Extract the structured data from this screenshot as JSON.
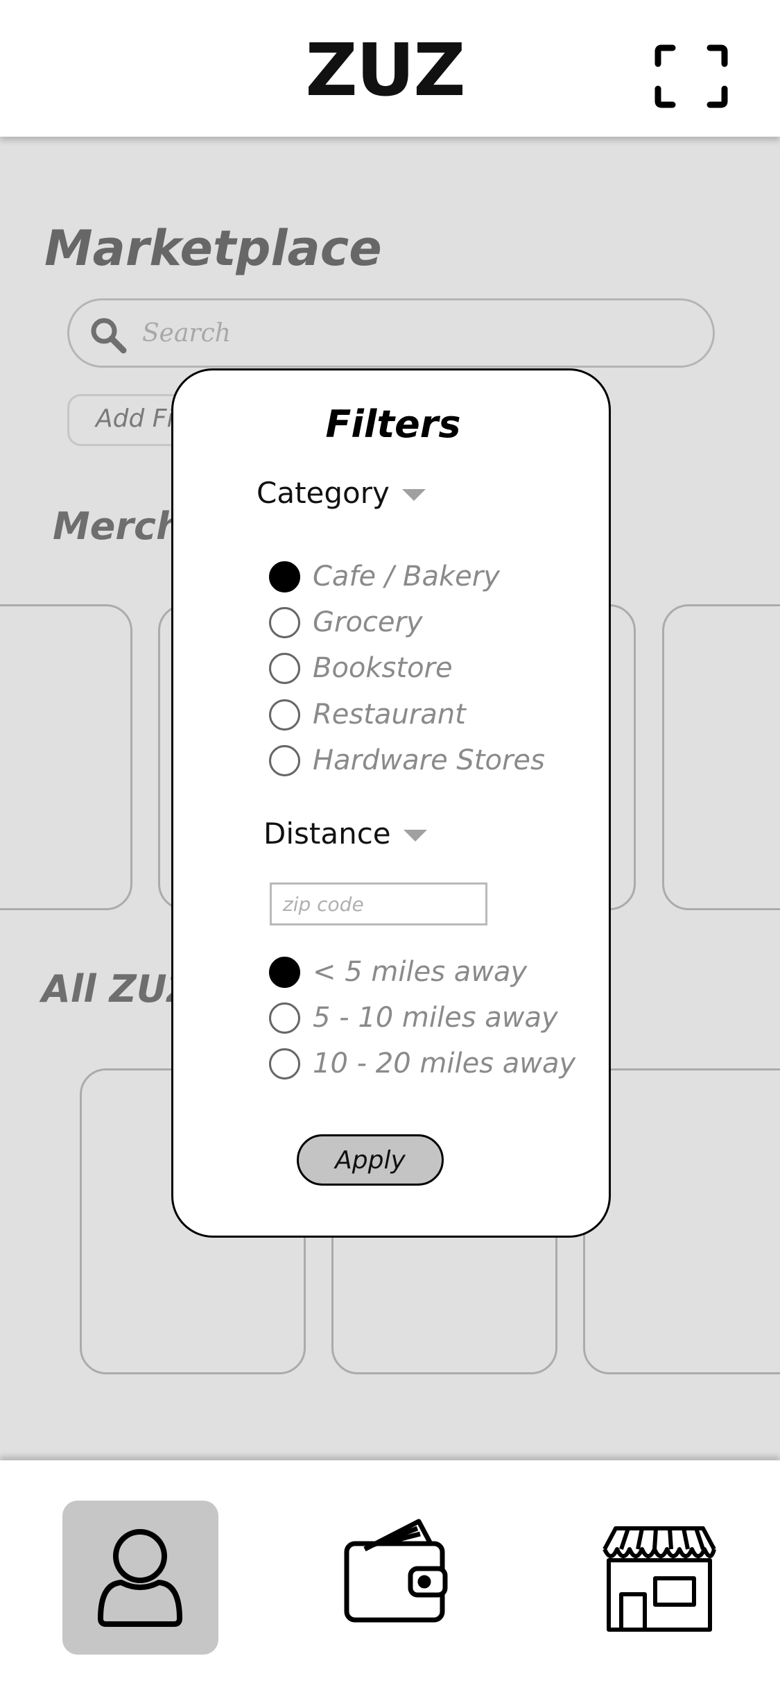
{
  "app": {
    "logo": "ZUZ"
  },
  "header": {
    "scan_icon": "scan-frame-icon"
  },
  "marketplace": {
    "title": "Marketplace",
    "search": {
      "placeholder": "Search",
      "icon": "search-icon"
    },
    "add_filter_label": "Add Fil",
    "merchants_heading": "Merch",
    "all_heading": "All ZUZ"
  },
  "filters": {
    "title": "Filters",
    "category": {
      "label": "Category",
      "options": [
        "Cafe / Bakery",
        "Grocery",
        "Bookstore",
        "Restaurant",
        "Hardware Stores"
      ],
      "selected": "Cafe / Bakery"
    },
    "distance": {
      "label": "Distance",
      "zip_placeholder": "zip code",
      "options": [
        "< 5 miles away",
        "5 - 10 miles away",
        "10 - 20 miles away"
      ],
      "selected": "< 5 miles away"
    },
    "apply_label": "Apply"
  },
  "tabbar": {
    "items": [
      {
        "icon": "profile-icon",
        "active": true
      },
      {
        "icon": "wallet-icon",
        "active": false
      },
      {
        "icon": "storefront-icon",
        "active": false
      }
    ]
  },
  "colors": {
    "backdrop": "#e0e0e0",
    "active_tab": "#c6c6c6",
    "selected_radio": "#000000"
  }
}
